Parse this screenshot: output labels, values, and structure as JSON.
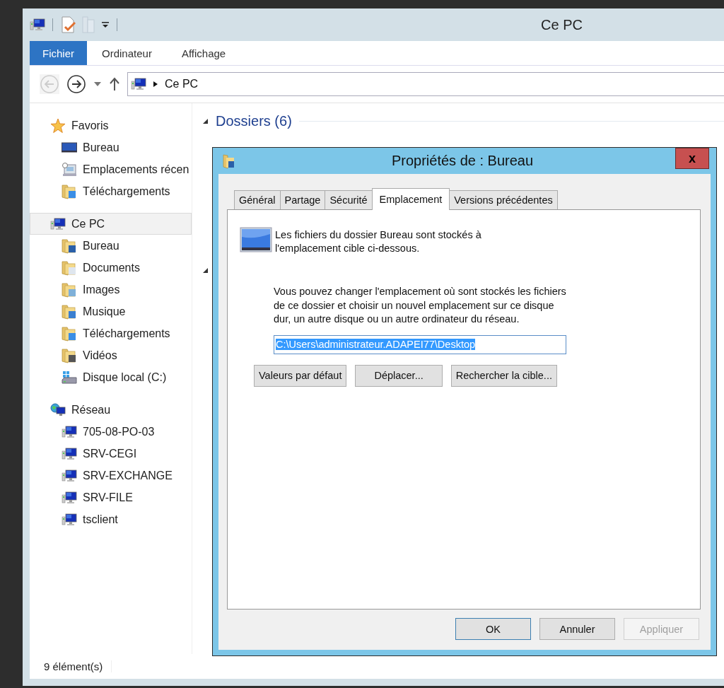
{
  "window": {
    "title": "Ce PC"
  },
  "ribbon_tabs": [
    {
      "label": "Fichier",
      "selected": true
    },
    {
      "label": "Ordinateur",
      "selected": false
    },
    {
      "label": "Affichage",
      "selected": false
    }
  ],
  "navigation": {
    "back_disabled": true,
    "forward_disabled": false
  },
  "address": {
    "path": [
      "Ce PC"
    ]
  },
  "sidebar": {
    "groups": [
      {
        "label": "Favoris",
        "kind": "favorites",
        "selected": false,
        "children": [
          {
            "label": "Bureau",
            "kind": "desktop",
            "selected": false
          },
          {
            "label": "Emplacements récen",
            "kind": "recent",
            "selected": false
          },
          {
            "label": "Téléchargements",
            "kind": "downloads",
            "selected": false
          }
        ]
      },
      {
        "label": "Ce PC",
        "kind": "pc",
        "selected": true,
        "children": [
          {
            "label": "Bureau",
            "kind": "folder-desktop",
            "selected": false
          },
          {
            "label": "Documents",
            "kind": "documents",
            "selected": false
          },
          {
            "label": "Images",
            "kind": "images",
            "selected": false
          },
          {
            "label": "Musique",
            "kind": "music",
            "selected": false
          },
          {
            "label": "Téléchargements",
            "kind": "downloads",
            "selected": false
          },
          {
            "label": "Vidéos",
            "kind": "videos",
            "selected": false
          },
          {
            "label": "Disque local (C:)",
            "kind": "drive",
            "selected": false
          }
        ]
      },
      {
        "label": "Réseau",
        "kind": "network",
        "selected": false,
        "children": [
          {
            "label": "705-08-PO-03",
            "kind": "computer",
            "selected": false
          },
          {
            "label": "SRV-CEGI",
            "kind": "computer",
            "selected": false
          },
          {
            "label": "SRV-EXCHANGE",
            "kind": "computer",
            "selected": false
          },
          {
            "label": "SRV-FILE",
            "kind": "computer",
            "selected": false
          },
          {
            "label": "tsclient",
            "kind": "computer",
            "selected": false
          }
        ]
      }
    ]
  },
  "content": {
    "group_header": "Dossiers (6)"
  },
  "status_bar": {
    "count": "9 élément(s)"
  },
  "dialog": {
    "title": "Propriétés de : Bureau",
    "close": "x",
    "tabs": [
      {
        "label": "Général",
        "selected": false
      },
      {
        "label": "Partage",
        "selected": false
      },
      {
        "label": "Sécurité",
        "selected": false
      },
      {
        "label": "Emplacement",
        "selected": true
      },
      {
        "label": "Versions précédentes",
        "selected": false
      }
    ],
    "info": "Les fichiers du dossier Bureau sont stockés à l'emplacement cible ci-dessous.",
    "description": "Vous pouvez changer l'emplacement où sont stockés les fichiers de ce dossier et choisir un nouvel emplacement sur ce disque dur, un autre disque ou un autre ordinateur du réseau.",
    "path_field": {
      "value": "C:\\Users\\administrateur.ADAPEI77\\Desktop",
      "selected": true
    },
    "actions": [
      {
        "label": "Valeurs par défaut"
      },
      {
        "label": "Déplacer..."
      },
      {
        "label": "Rechercher la cible..."
      }
    ],
    "buttons": [
      {
        "label": "OK",
        "default": true,
        "disabled": false
      },
      {
        "label": "Annuler",
        "default": false,
        "disabled": false
      },
      {
        "label": "Appliquer",
        "default": false,
        "disabled": true
      }
    ]
  }
}
